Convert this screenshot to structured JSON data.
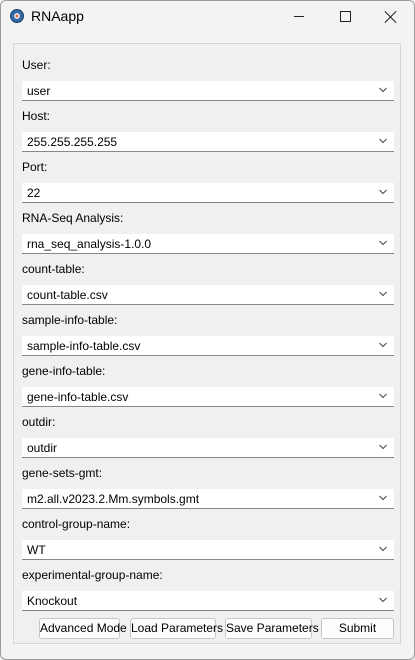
{
  "window": {
    "title": "RNAapp",
    "icon": "app-logo-icon",
    "controls": [
      "minimize-icon",
      "maximize-icon",
      "close-icon"
    ]
  },
  "form": {
    "fields": [
      {
        "label": "User:",
        "value": "user"
      },
      {
        "label": "Host:",
        "value": "255.255.255.255"
      },
      {
        "label": "Port:",
        "value": "22"
      },
      {
        "label": "RNA-Seq Analysis:",
        "value": "rna_seq_analysis-1.0.0"
      },
      {
        "label": "count-table:",
        "value": "count-table.csv"
      },
      {
        "label": "sample-info-table:",
        "value": "sample-info-table.csv"
      },
      {
        "label": "gene-info-table:",
        "value": "gene-info-table.csv"
      },
      {
        "label": "outdir:",
        "value": "outdir"
      },
      {
        "label": "gene-sets-gmt:",
        "value": "m2.all.v2023.2.Mm.symbols.gmt"
      },
      {
        "label": "control-group-name:",
        "value": "WT"
      },
      {
        "label": "experimental-group-name:",
        "value": "Knockout"
      }
    ]
  },
  "buttons": {
    "advanced": "Advanced Mode",
    "load": "Load Parameters",
    "save": "Save Parameters",
    "submit": "Submit"
  }
}
